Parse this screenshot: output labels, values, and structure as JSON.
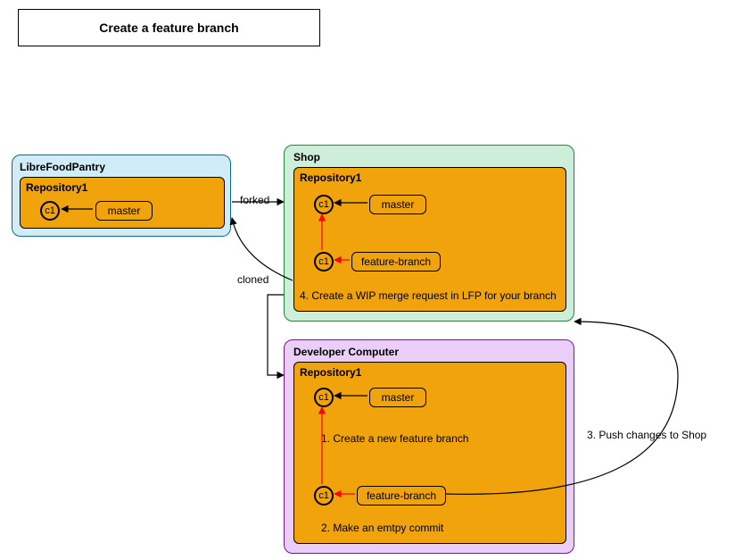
{
  "title": "Create a feature branch",
  "lfp": {
    "title": "LibreFoodPantry",
    "repo_title": "Repository1",
    "commit": "c1",
    "branch_master": "master"
  },
  "shop": {
    "title": "Shop",
    "repo_title": "Repository1",
    "commit_top": "c1",
    "branch_master": "master",
    "commit_bottom": "c1",
    "branch_feature": "feature-branch",
    "step4": "4. Create a WIP merge request in LFP for your branch"
  },
  "dev": {
    "title": "Developer Computer",
    "repo_title": "Repository1",
    "commit_top": "c1",
    "branch_master": "master",
    "step1": "1. Create a new feature branch",
    "commit_bottom": "c1",
    "branch_feature": "feature-branch",
    "step2": "2. Make an emtpy commit"
  },
  "edges": {
    "forked": "forked",
    "cloned": "cloned",
    "step3": "3. Push changes to Shop"
  },
  "chart_data": {
    "type": "diagram",
    "title": "Create a feature branch",
    "nodes": [
      {
        "id": "lfp",
        "label": "LibreFoodPantry",
        "children": [
          {
            "id": "lfp_repo",
            "label": "Repository1",
            "children": [
              {
                "id": "lfp_c1",
                "type": "commit",
                "label": "c1"
              },
              {
                "id": "lfp_master",
                "type": "branch",
                "label": "master"
              }
            ]
          }
        ]
      },
      {
        "id": "shop",
        "label": "Shop",
        "children": [
          {
            "id": "shop_repo",
            "label": "Repository1",
            "children": [
              {
                "id": "shop_c1_top",
                "type": "commit",
                "label": "c1"
              },
              {
                "id": "shop_master",
                "type": "branch",
                "label": "master"
              },
              {
                "id": "shop_c1_bot",
                "type": "commit",
                "label": "c1"
              },
              {
                "id": "shop_feature",
                "type": "branch",
                "label": "feature-branch"
              }
            ]
          }
        ]
      },
      {
        "id": "dev",
        "label": "Developer Computer",
        "children": [
          {
            "id": "dev_repo",
            "label": "Repository1",
            "children": [
              {
                "id": "dev_c1_top",
                "type": "commit",
                "label": "c1"
              },
              {
                "id": "dev_master",
                "type": "branch",
                "label": "master"
              },
              {
                "id": "dev_c1_bot",
                "type": "commit",
                "label": "c1"
              },
              {
                "id": "dev_feature",
                "type": "branch",
                "label": "feature-branch"
              }
            ]
          }
        ]
      }
    ],
    "edges": [
      {
        "from": "lfp_repo",
        "to": "shop_repo",
        "label": "forked",
        "style": "black"
      },
      {
        "from": "shop_repo",
        "to": "dev_repo",
        "label": "cloned",
        "style": "black-curve"
      },
      {
        "from": "lfp_master",
        "to": "lfp_c1",
        "label": "",
        "style": "black"
      },
      {
        "from": "shop_master",
        "to": "shop_c1_top",
        "label": "",
        "style": "black"
      },
      {
        "from": "shop_feature",
        "to": "shop_c1_bot",
        "label": "",
        "style": "red"
      },
      {
        "from": "shop_c1_bot",
        "to": "shop_c1_top",
        "label": "",
        "style": "red"
      },
      {
        "from": "dev_master",
        "to": "dev_c1_top",
        "label": "",
        "style": "black"
      },
      {
        "from": "dev_feature",
        "to": "dev_c1_bot",
        "label": "",
        "style": "red"
      },
      {
        "from": "dev_c1_bot",
        "to": "dev_c1_top",
        "label": "",
        "style": "red"
      },
      {
        "from": "dev_feature",
        "to": "shop_repo",
        "label": "3. Push changes to Shop",
        "style": "black-curve"
      },
      {
        "from": "shop_repo",
        "to": "lfp_repo",
        "label": "4. Create a WIP merge request in LFP for your branch",
        "style": "black-curve"
      }
    ],
    "annotations": [
      {
        "at": "dev",
        "text": "1. Create a new feature branch"
      },
      {
        "at": "dev",
        "text": "2. Make an emtpy commit"
      }
    ]
  }
}
